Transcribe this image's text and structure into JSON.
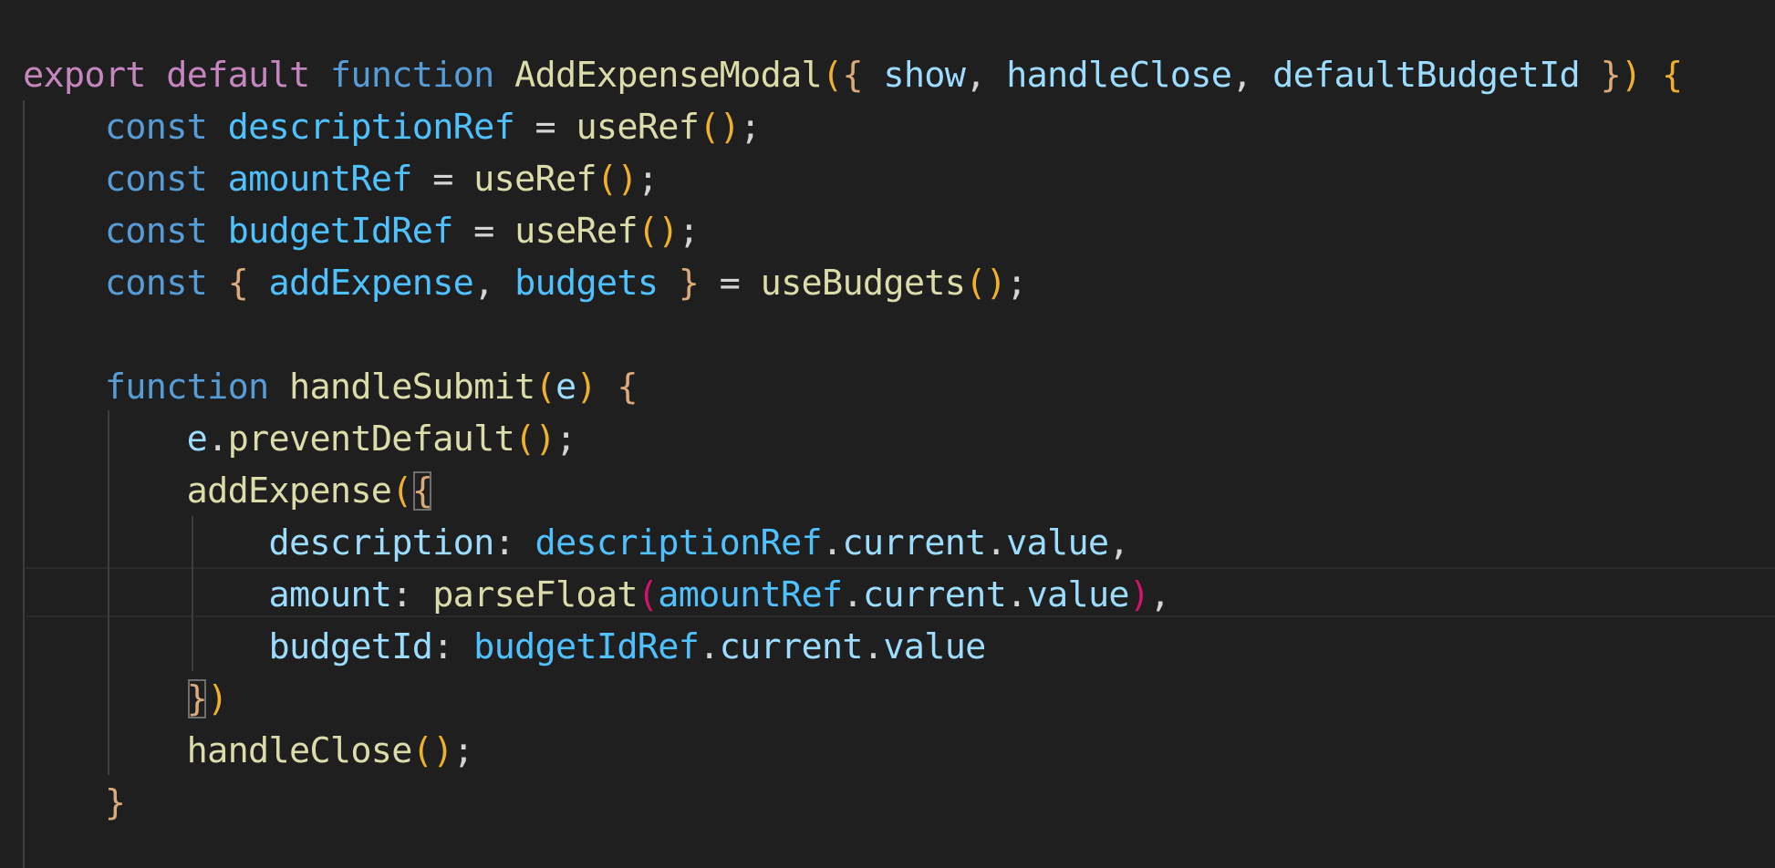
{
  "editor": {
    "language": "javascript",
    "theme": "dark",
    "colors": {
      "background": "#1f1f1f",
      "keyword": "#c586c0",
      "storage": "#569cd6",
      "function": "#dcdcaa",
      "variable": "#9cdcfe",
      "constant": "#4fc1ff",
      "bracket": "#f0b02c",
      "curly": "#dcaa7a",
      "bracket_pink": "#d1136a"
    },
    "lines": [
      {
        "tokens": [
          {
            "t": "export",
            "c": "t-kw"
          },
          {
            "t": " ",
            "c": "t-punc"
          },
          {
            "t": "default",
            "c": "t-kw"
          },
          {
            "t": " ",
            "c": "t-punc"
          },
          {
            "t": "function",
            "c": "t-storage"
          },
          {
            "t": " ",
            "c": "t-punc"
          },
          {
            "t": "AddExpenseModal",
            "c": "t-fn"
          },
          {
            "t": "(",
            "c": "t-paren"
          },
          {
            "t": "{",
            "c": "t-curly"
          },
          {
            "t": " ",
            "c": "t-punc"
          },
          {
            "t": "show",
            "c": "t-var"
          },
          {
            "t": ", ",
            "c": "t-punc"
          },
          {
            "t": "handleClose",
            "c": "t-var"
          },
          {
            "t": ", ",
            "c": "t-punc"
          },
          {
            "t": "defaultBudgetId",
            "c": "t-var"
          },
          {
            "t": " ",
            "c": "t-punc"
          },
          {
            "t": "}",
            "c": "t-curly"
          },
          {
            "t": ")",
            "c": "t-paren"
          },
          {
            "t": " ",
            "c": "t-punc"
          },
          {
            "t": "{",
            "c": "t-paren"
          }
        ]
      },
      {
        "tokens": [
          {
            "t": "    ",
            "c": "t-punc"
          },
          {
            "t": "const",
            "c": "t-storage"
          },
          {
            "t": " ",
            "c": "t-punc"
          },
          {
            "t": "descriptionRef",
            "c": "t-const"
          },
          {
            "t": " = ",
            "c": "t-punc"
          },
          {
            "t": "useRef",
            "c": "t-fn"
          },
          {
            "t": "()",
            "c": "t-paren"
          },
          {
            "t": ";",
            "c": "t-punc"
          }
        ]
      },
      {
        "tokens": [
          {
            "t": "    ",
            "c": "t-punc"
          },
          {
            "t": "const",
            "c": "t-storage"
          },
          {
            "t": " ",
            "c": "t-punc"
          },
          {
            "t": "amountRef",
            "c": "t-const"
          },
          {
            "t": " = ",
            "c": "t-punc"
          },
          {
            "t": "useRef",
            "c": "t-fn"
          },
          {
            "t": "()",
            "c": "t-paren"
          },
          {
            "t": ";",
            "c": "t-punc"
          }
        ]
      },
      {
        "tokens": [
          {
            "t": "    ",
            "c": "t-punc"
          },
          {
            "t": "const",
            "c": "t-storage"
          },
          {
            "t": " ",
            "c": "t-punc"
          },
          {
            "t": "budgetIdRef",
            "c": "t-const"
          },
          {
            "t": " = ",
            "c": "t-punc"
          },
          {
            "t": "useRef",
            "c": "t-fn"
          },
          {
            "t": "()",
            "c": "t-paren"
          },
          {
            "t": ";",
            "c": "t-punc"
          }
        ]
      },
      {
        "tokens": [
          {
            "t": "    ",
            "c": "t-punc"
          },
          {
            "t": "const",
            "c": "t-storage"
          },
          {
            "t": " ",
            "c": "t-punc"
          },
          {
            "t": "{",
            "c": "t-curly"
          },
          {
            "t": " ",
            "c": "t-punc"
          },
          {
            "t": "addExpense",
            "c": "t-const"
          },
          {
            "t": ", ",
            "c": "t-punc"
          },
          {
            "t": "budgets",
            "c": "t-const"
          },
          {
            "t": " ",
            "c": "t-punc"
          },
          {
            "t": "}",
            "c": "t-curly"
          },
          {
            "t": " = ",
            "c": "t-punc"
          },
          {
            "t": "useBudgets",
            "c": "t-fn"
          },
          {
            "t": "()",
            "c": "t-paren"
          },
          {
            "t": ";",
            "c": "t-punc"
          }
        ]
      },
      {
        "tokens": []
      },
      {
        "tokens": [
          {
            "t": "    ",
            "c": "t-punc"
          },
          {
            "t": "function",
            "c": "t-storage"
          },
          {
            "t": " ",
            "c": "t-punc"
          },
          {
            "t": "handleSubmit",
            "c": "t-fn"
          },
          {
            "t": "(",
            "c": "t-paren"
          },
          {
            "t": "e",
            "c": "t-var"
          },
          {
            "t": ")",
            "c": "t-paren"
          },
          {
            "t": " ",
            "c": "t-punc"
          },
          {
            "t": "{",
            "c": "t-curly"
          }
        ]
      },
      {
        "tokens": [
          {
            "t": "        ",
            "c": "t-punc"
          },
          {
            "t": "e",
            "c": "t-var"
          },
          {
            "t": ".",
            "c": "t-punc"
          },
          {
            "t": "preventDefault",
            "c": "t-fn"
          },
          {
            "t": "()",
            "c": "t-paren"
          },
          {
            "t": ";",
            "c": "t-punc"
          }
        ]
      },
      {
        "tokens": [
          {
            "t": "        ",
            "c": "t-punc"
          },
          {
            "t": "addExpense",
            "c": "t-fn"
          },
          {
            "t": "(",
            "c": "t-paren"
          },
          {
            "t": "{",
            "c": "t-curly",
            "match": true
          }
        ]
      },
      {
        "tokens": [
          {
            "t": "            ",
            "c": "t-punc"
          },
          {
            "t": "description",
            "c": "t-var"
          },
          {
            "t": ": ",
            "c": "t-punc"
          },
          {
            "t": "descriptionRef",
            "c": "t-const"
          },
          {
            "t": ".",
            "c": "t-punc"
          },
          {
            "t": "current",
            "c": "t-var"
          },
          {
            "t": ".",
            "c": "t-punc"
          },
          {
            "t": "value",
            "c": "t-var"
          },
          {
            "t": ",",
            "c": "t-punc"
          }
        ]
      },
      {
        "tokens": [
          {
            "t": "            ",
            "c": "t-punc"
          },
          {
            "t": "amount",
            "c": "t-var"
          },
          {
            "t": ": ",
            "c": "t-punc"
          },
          {
            "t": "parseFloat",
            "c": "t-fn"
          },
          {
            "t": "(",
            "c": "t-pink"
          },
          {
            "t": "amountRef",
            "c": "t-const"
          },
          {
            "t": ".",
            "c": "t-punc"
          },
          {
            "t": "current",
            "c": "t-var"
          },
          {
            "t": ".",
            "c": "t-punc"
          },
          {
            "t": "value",
            "c": "t-var"
          },
          {
            "t": ")",
            "c": "t-pink"
          },
          {
            "t": ",",
            "c": "t-punc"
          }
        ]
      },
      {
        "tokens": [
          {
            "t": "            ",
            "c": "t-punc"
          },
          {
            "t": "budgetId",
            "c": "t-var"
          },
          {
            "t": ": ",
            "c": "t-punc"
          },
          {
            "t": "budgetIdRef",
            "c": "t-const"
          },
          {
            "t": ".",
            "c": "t-punc"
          },
          {
            "t": "current",
            "c": "t-var"
          },
          {
            "t": ".",
            "c": "t-punc"
          },
          {
            "t": "value",
            "c": "t-var"
          }
        ]
      },
      {
        "tokens": [
          {
            "t": "        ",
            "c": "t-punc"
          },
          {
            "t": "}",
            "c": "t-curly",
            "match": true
          },
          {
            "t": ")",
            "c": "t-paren"
          }
        ]
      },
      {
        "tokens": [
          {
            "t": "        ",
            "c": "t-punc"
          },
          {
            "t": "handleClose",
            "c": "t-fn"
          },
          {
            "t": "()",
            "c": "t-paren"
          },
          {
            "t": ";",
            "c": "t-punc"
          }
        ]
      },
      {
        "tokens": [
          {
            "t": "    ",
            "c": "t-punc"
          },
          {
            "t": "}",
            "c": "t-curly"
          }
        ]
      }
    ]
  }
}
